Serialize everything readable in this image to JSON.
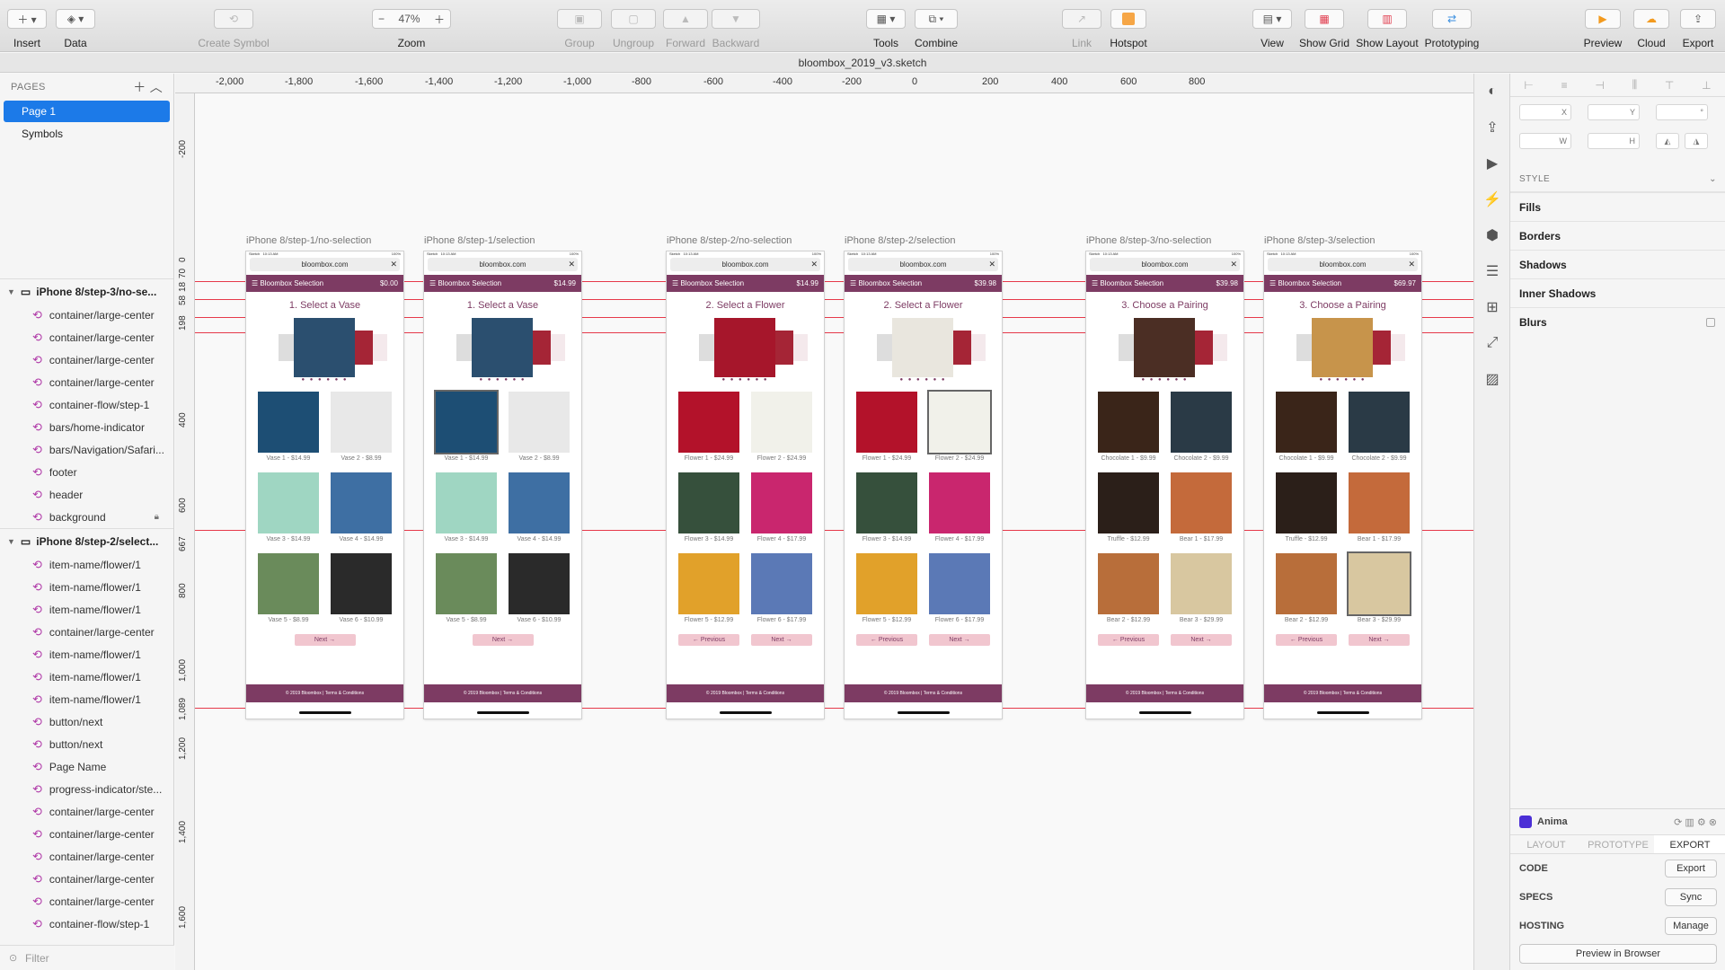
{
  "toolbar": {
    "insert": "Insert",
    "data": "Data",
    "create_symbol": "Create Symbol",
    "zoom_value": "47%",
    "zoom": "Zoom",
    "group": "Group",
    "ungroup": "Ungroup",
    "forward": "Forward",
    "backward": "Backward",
    "tools": "Tools",
    "combine": "Combine",
    "link": "Link",
    "hotspot": "Hotspot",
    "view": "View",
    "show_grid": "Show Grid",
    "show_layout": "Show Layout",
    "prototyping": "Prototyping",
    "preview": "Preview",
    "cloud": "Cloud",
    "export": "Export"
  },
  "document_title": "bloombox_2019_v3.sketch",
  "pages": {
    "header": "PAGES",
    "items": [
      "Page 1",
      "Symbols"
    ]
  },
  "layers": {
    "group1": "iPhone 8/step-3/no-se...",
    "group1_items": [
      "container/large-center",
      "container/large-center",
      "container/large-center",
      "container/large-center",
      "container-flow/step-1",
      "bars/home-indicator",
      "bars/Navigation/Safari...",
      "footer",
      "header",
      "background"
    ],
    "group2": "iPhone 8/step-2/select...",
    "group2_items": [
      "item-name/flower/1",
      "item-name/flower/1",
      "item-name/flower/1",
      "container/large-center",
      "item-name/flower/1",
      "item-name/flower/1",
      "item-name/flower/1",
      "button/next",
      "button/next",
      "Page Name",
      "progress-indicator/ste...",
      "container/large-center",
      "container/large-center",
      "container/large-center",
      "container/large-center",
      "container/large-center",
      "container-flow/step-1"
    ],
    "filter": "Filter"
  },
  "ruler": {
    "top": [
      "-2,000",
      "-1,800",
      "-1,600",
      "-1,400",
      "-1,200",
      "-1,000",
      "-800",
      "-600",
      "-400",
      "-200",
      "0",
      "200",
      "400",
      "600",
      "800"
    ],
    "left": [
      "-200",
      "0",
      "70",
      "18",
      "58",
      "198",
      "400",
      "600",
      "667",
      "800",
      "1,000",
      "1,089",
      "1,200",
      "1,400",
      "1,600"
    ]
  },
  "phone": {
    "status_left": "Sketch",
    "status_time": "10:13 AM",
    "status_right": "100%",
    "url": "bloombox.com",
    "brand": "Bloombox Selection",
    "footer": "© 2019 Bloombox | Terms & Conditions",
    "dots": "● ● ● ● ● ●",
    "previous": "← Previous",
    "next": "Next →"
  },
  "artboards": [
    {
      "title": "iPhone 8/step-1/no-selection",
      "price": "$0.00",
      "step": "1. Select a Vase",
      "items": [
        "Vase 1 - $14.99",
        "Vase 2 - $8.99",
        "Vase 3 - $14.99",
        "Vase 4 - $14.99",
        "Vase 5 - $8.99",
        "Vase 6 - $10.99"
      ]
    },
    {
      "title": "iPhone 8/step-1/selection",
      "price": "$14.99",
      "step": "1. Select a Vase",
      "items": [
        "Vase 1 - $14.99",
        "Vase 2 - $8.99",
        "Vase 3 - $14.99",
        "Vase 4 - $14.99",
        "Vase 5 - $8.99",
        "Vase 6 - $10.99"
      ]
    },
    {
      "title": "iPhone 8/step-2/no-selection",
      "price": "$14.99",
      "step": "2. Select a Flower",
      "items": [
        "Flower 1 - $24.99",
        "Flower 2 - $24.99",
        "Flower 3 - $14.99",
        "Flower 4 - $17.99",
        "Flower 5 - $12.99",
        "Flower 6 - $17.99"
      ]
    },
    {
      "title": "iPhone 8/step-2/selection",
      "price": "$39.98",
      "step": "2. Select a Flower",
      "items": [
        "Flower 1 - $24.99",
        "Flower 2 - $24.99",
        "Flower 3 - $14.99",
        "Flower 4 - $17.99",
        "Flower 5 - $12.99",
        "Flower 6 - $17.99"
      ]
    },
    {
      "title": "iPhone 8/step-3/no-selection",
      "price": "$39.98",
      "step": "3. Choose a Pairing",
      "items": [
        "Chocolate 1 - $9.99",
        "Chocolate 2 - $9.99",
        "Truffle - $12.99",
        "Bear 1 - $17.99",
        "Bear 2 - $12.99",
        "Bear 3 - $29.99"
      ]
    },
    {
      "title": "iPhone 8/step-3/selection",
      "price": "$69.97",
      "step": "3. Choose a Pairing",
      "items": [
        "Chocolate 1 - $9.99",
        "Chocolate 2 - $9.99",
        "Truffle - $12.99",
        "Bear 1 - $17.99",
        "Bear 2 - $12.99",
        "Bear 3 - $29.99"
      ]
    }
  ],
  "inspector": {
    "x": "X",
    "y": "Y",
    "deg": "°",
    "w": "W",
    "h": "H",
    "style": "STYLE",
    "fills": "Fills",
    "borders": "Borders",
    "shadows": "Shadows",
    "inner_shadows": "Inner Shadows",
    "blurs": "Blurs"
  },
  "anima": {
    "title": "Anima",
    "tabs": [
      "LAYOUT",
      "PROTOTYPE",
      "EXPORT"
    ],
    "code": "CODE",
    "code_btn": "Export",
    "specs": "SPECS",
    "specs_btn": "Sync",
    "hosting": "HOSTING",
    "hosting_btn": "Manage",
    "preview": "Preview in Browser"
  },
  "colors": {
    "brand": "#7d3b63",
    "button_pink": "#f1c6cf",
    "selection_blue": "#1c7ae8",
    "guide_red": "#e6394a"
  }
}
